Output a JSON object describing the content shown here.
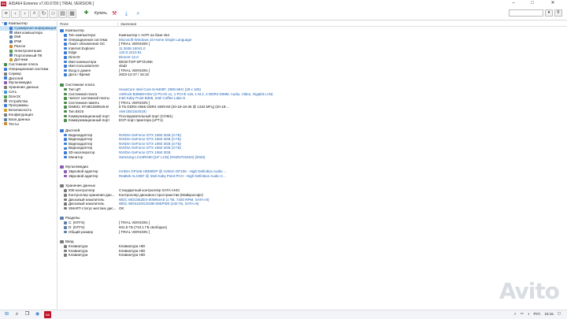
{
  "window": {
    "app_icon": "64",
    "title": "AIDA64 Extreme v7.00.6700 [ TRIAL VERSION ]",
    "minimize": "–",
    "maximize": "□",
    "close": "✕"
  },
  "toolbar": {
    "buy_label": "Купить",
    "search_placeholder": ""
  },
  "tree": [
    {
      "label": "Компьютер",
      "level": 0,
      "toggle": "▾",
      "color": "#3a7bd5",
      "selected": false
    },
    {
      "label": "Суммарная информация",
      "level": 1,
      "toggle": "",
      "color": "#3a7bd5",
      "selected": true
    },
    {
      "label": "Имя компьютера",
      "level": 1,
      "toggle": "",
      "color": "#6b8fb8",
      "selected": false
    },
    {
      "label": "DMI",
      "level": 1,
      "toggle": "",
      "color": "#5b7fa8",
      "selected": false
    },
    {
      "label": "IPMI",
      "level": 1,
      "toggle": "",
      "color": "#5b7fa8",
      "selected": false
    },
    {
      "label": "Разгон",
      "level": 1,
      "toggle": "",
      "color": "#d08a2a",
      "selected": false
    },
    {
      "label": "Электропитание",
      "level": 1,
      "toggle": "",
      "color": "#4a9a4a",
      "selected": false
    },
    {
      "label": "Портативный ПК",
      "level": 1,
      "toggle": "",
      "color": "#5b7fa8",
      "selected": false
    },
    {
      "label": "Датчики",
      "level": 1,
      "toggle": "",
      "color": "#d0a02a",
      "selected": false
    },
    {
      "label": "Системная плата",
      "level": 0,
      "toggle": "›",
      "color": "#4a8a4a",
      "selected": false
    },
    {
      "label": "Операционная система",
      "level": 0,
      "toggle": "›",
      "color": "#3a7bd5",
      "selected": false
    },
    {
      "label": "Сервер",
      "level": 0,
      "toggle": "›",
      "color": "#7a7a7a",
      "selected": false
    },
    {
      "label": "Дисплей",
      "level": 0,
      "toggle": "›",
      "color": "#3a7bd5",
      "selected": false
    },
    {
      "label": "Мультимедиа",
      "level": 0,
      "toggle": "›",
      "color": "#8a5ab5",
      "selected": false
    },
    {
      "label": "Хранение данных",
      "level": 0,
      "toggle": "›",
      "color": "#7a7a7a",
      "selected": false
    },
    {
      "label": "Сеть",
      "level": 0,
      "toggle": "›",
      "color": "#3a9ad5",
      "selected": false
    },
    {
      "label": "DirectX",
      "level": 0,
      "toggle": "›",
      "color": "#4aa04a",
      "selected": false
    },
    {
      "label": "Устройства",
      "level": 0,
      "toggle": "›",
      "color": "#7a7a7a",
      "selected": false
    },
    {
      "label": "Программы",
      "level": 0,
      "toggle": "›",
      "color": "#3a7bd5",
      "selected": false
    },
    {
      "label": "Безопасность",
      "level": 0,
      "toggle": "›",
      "color": "#d0a02a",
      "selected": false
    },
    {
      "label": "Конфигурация",
      "level": 0,
      "toggle": "›",
      "color": "#7a7a7a",
      "selected": false
    },
    {
      "label": "База данных",
      "level": 0,
      "toggle": "›",
      "color": "#5b7fa8",
      "selected": false
    },
    {
      "label": "Тесты",
      "level": 0,
      "toggle": "›",
      "color": "#d08a2a",
      "selected": false
    }
  ],
  "table": {
    "col_field": "Поле",
    "col_value": "Значение",
    "sections": [
      {
        "title": "Компьютер",
        "color": "#3a7bd5",
        "rows": [
          {
            "field": "Тип компьютера",
            "value": "Компьютер с ACPI на базе x64",
            "link": false
          },
          {
            "field": "Операционная система",
            "value": "Microsoft Windows 10 Home Single Language",
            "link": true
          },
          {
            "field": "Пакет обновления ОС",
            "value": "[ TRIAL VERSION ]",
            "link": false
          },
          {
            "field": "Internet Explorer",
            "value": "11.3636.19041.0",
            "link": true
          },
          {
            "field": "Edge",
            "value": "120.0.2210.91",
            "link": true
          },
          {
            "field": "DirectX",
            "value": "DirectX 12.0",
            "link": true
          },
          {
            "field": "Имя компьютера",
            "value": "DESKTOP-0P7ZUNK",
            "link": false
          },
          {
            "field": "Имя пользователя",
            "value": "vladz",
            "link": false
          },
          {
            "field": "Вход в домен",
            "value": "[ TRIAL VERSION ]",
            "link": false
          },
          {
            "field": "Дата / Время",
            "value": "2023-12-27 / 16:15",
            "link": false
          }
        ]
      },
      {
        "title": "Системная плата",
        "color": "#4a8a4a",
        "rows": [
          {
            "field": "Тип ЦП",
            "value": "HexaCore Intel Core i5-9400F, 2900 MHz (29 x 100)",
            "link": true
          },
          {
            "field": "Системная плата",
            "value": "ASRock B365M-HDV  (2 PCI-E x1, 1 PCI-E x16, 1 M.2, 2 DDR4 DIMM, Audio, Video, Gigabit LAN)",
            "link": true
          },
          {
            "field": "Чипсет системной платы",
            "value": "Intel Kaby Point B365, Intel Coffee Lake-S",
            "link": true
          },
          {
            "field": "Системная память",
            "value": "[ TRIAL VERSION ]",
            "link": false
          },
          {
            "field": "DIMM1: 8T48G2808U5-B",
            "value": "8 ГБ DDR4-2666 DDR4 SDRAM  (20-18-18-35 @ 1333 МГц)  (20-18-...",
            "link": false
          },
          {
            "field": "Тип BIOS",
            "value": "AMI (05/15/2019)",
            "link": true
          },
          {
            "field": "Коммуникационный порт",
            "value": "Последовательный порт (COM1)",
            "link": false
          },
          {
            "field": "Коммуникационный порт",
            "value": "ECP-порт принтера (LPT1)",
            "link": false
          }
        ]
      },
      {
        "title": "Дисплей",
        "color": "#3a7bd5",
        "rows": [
          {
            "field": "Видеоадаптер",
            "value": "NVIDIA GeForce GTX 1060 3GB  (3 ГБ)",
            "link": true
          },
          {
            "field": "Видеоадаптер",
            "value": "NVIDIA GeForce GTX 1060 3GB  (3 ГБ)",
            "link": true
          },
          {
            "field": "Видеоадаптер",
            "value": "NVIDIA GeForce GTX 1060 3GB  (3 ГБ)",
            "link": true
          },
          {
            "field": "Видеоадаптер",
            "value": "NVIDIA GeForce GTX 1060 3GB  (3 ГБ)",
            "link": true
          },
          {
            "field": "3D-акселератор",
            "value": "NVIDIA GeForce GTX 1060 3GB",
            "link": true
          },
          {
            "field": "Монитор",
            "value": "Samsung LC24RG50 [24\" LCD]  (HNZN701810)  {2020}",
            "link": true
          }
        ]
      },
      {
        "title": "Мультимедиа",
        "color": "#8a5ab5",
        "rows": [
          {
            "field": "Звуковой адаптер",
            "value": "nVIDIA GP106 HDMI/DP @ nVIDIA GP106 - High Definition Audio ...",
            "link": true
          },
          {
            "field": "Звуковой адаптер",
            "value": "Realtek ALC887 @ Intel Kaby Point PCH - High Definition Audio C...",
            "link": true
          }
        ]
      },
      {
        "title": "Хранение данных",
        "color": "#7a7a7a",
        "rows": [
          {
            "field": "IDE-контроллер",
            "value": "Стандартный контроллер SATA AHCI",
            "link": false
          },
          {
            "field": "Контроллер хранения дан...",
            "value": "Контроллер дискового пространства (Майкрософт)",
            "link": false
          },
          {
            "field": "Дисковый накопитель",
            "value": "WDC WD10EZEX-00WN4A0  (1 TB, 7200 RPM, SATA-III)",
            "link": true
          },
          {
            "field": "Дисковый накопитель",
            "value": "WDC WDS240G2G0B-00EPW0  (240 ГБ, SATA-III)",
            "link": true
          },
          {
            "field": "SMART-статус жестких дис...",
            "value": "OK",
            "link": false
          }
        ]
      },
      {
        "title": "Разделы",
        "color": "#5b7fa8",
        "rows": [
          {
            "field": "C: (NTFS)",
            "value": "[ TRIAL VERSION ]",
            "link": false
          },
          {
            "field": "D: (NTFS)",
            "value": "931.5 ГБ (743.1 ГБ свободно)",
            "link": false
          },
          {
            "field": "Общий размер",
            "value": "[ TRIAL VERSION ]",
            "link": false
          }
        ]
      },
      {
        "title": "Ввод",
        "color": "#7a7a7a",
        "rows": [
          {
            "field": "Клавиатура",
            "value": "Клавиатура HID",
            "link": false
          },
          {
            "field": "Клавиатура",
            "value": "Клавиатура HID",
            "link": false
          },
          {
            "field": "Клавиатура",
            "value": "Клавиатура HID",
            "link": false
          }
        ]
      }
    ]
  },
  "taskbar": {
    "app_badge": "64",
    "time": "16:15",
    "lang": "РУС"
  },
  "watermark": "Avito"
}
